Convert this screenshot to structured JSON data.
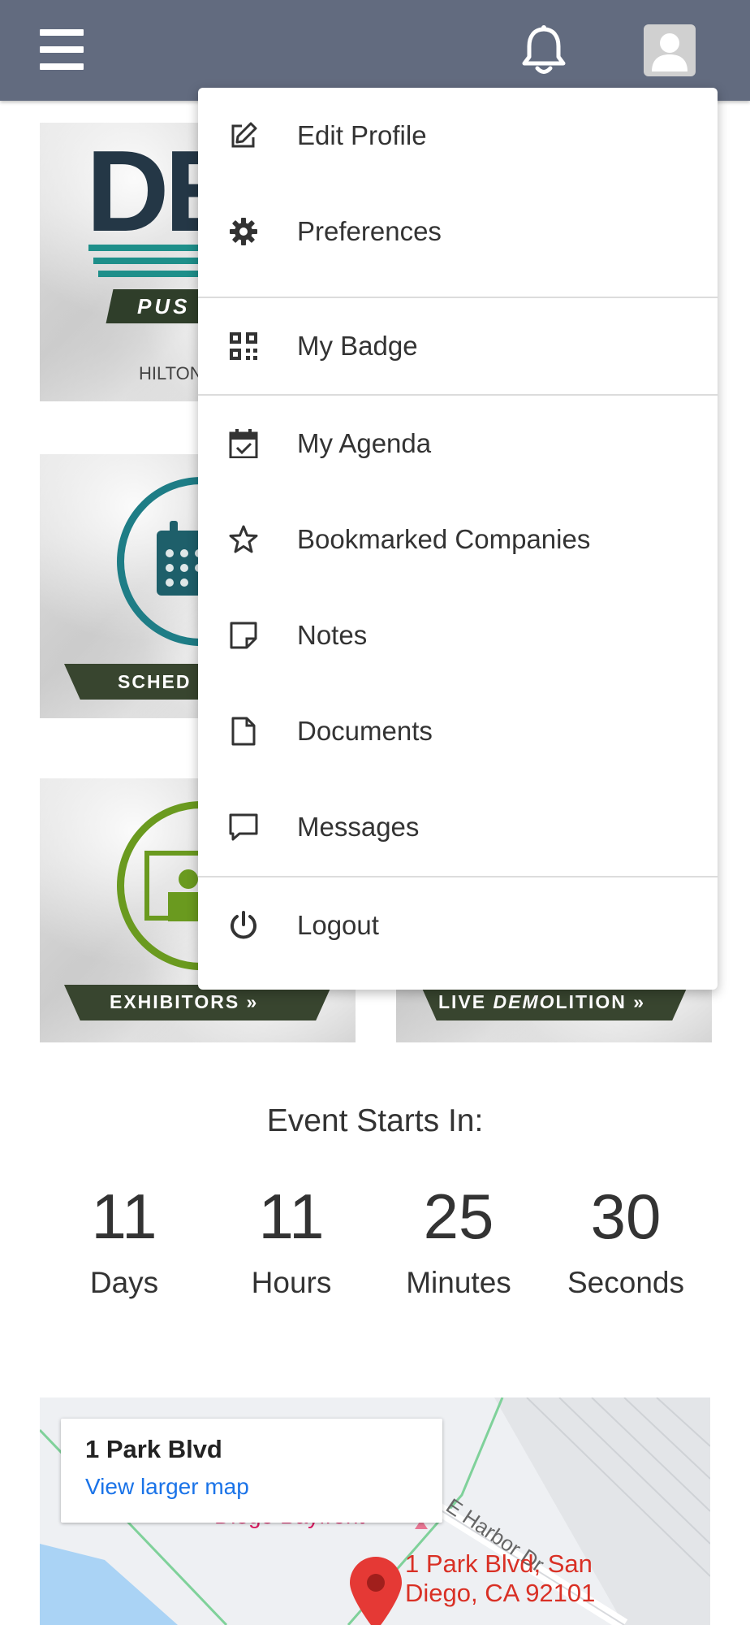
{
  "topbar": {
    "menu_icon": "hamburger-menu-icon",
    "notification_icon": "bell-icon",
    "avatar_icon": "user-avatar-icon"
  },
  "tiles": {
    "logo": {
      "text": "DE",
      "banner": "PUS",
      "sub": "HILTON"
    },
    "schedule": {
      "banner": "SCHED"
    },
    "exhibitors": {
      "banner": "EXHIBITORS »"
    },
    "demolition": {
      "banner_pre": "LIVE ",
      "banner_em": "DEMO",
      "banner_post": "LITION »"
    }
  },
  "user_menu": {
    "items": [
      {
        "label": "Edit Profile",
        "icon": "edit-icon"
      },
      {
        "label": "Preferences",
        "icon": "gear-icon"
      },
      {
        "label": "My Badge",
        "icon": "qr-code-icon"
      },
      {
        "label": "My Agenda",
        "icon": "calendar-check-icon"
      },
      {
        "label": "Bookmarked Companies",
        "icon": "star-icon"
      },
      {
        "label": "Notes",
        "icon": "note-icon"
      },
      {
        "label": "Documents",
        "icon": "document-icon"
      },
      {
        "label": "Messages",
        "icon": "message-icon"
      },
      {
        "label": "Logout",
        "icon": "power-icon"
      }
    ]
  },
  "countdown": {
    "title": "Event Starts In:",
    "units": [
      {
        "value": "11",
        "label": "Days"
      },
      {
        "value": "11",
        "label": "Hours"
      },
      {
        "value": "25",
        "label": "Minutes"
      },
      {
        "value": "30",
        "label": "Seconds"
      }
    ]
  },
  "map": {
    "place_title": "1 Park Blvd",
    "larger_map_link": "View larger map",
    "address_line1": "1 Park Blvd, San",
    "address_line2": "Diego, CA 92101",
    "street_label": "E Harbor Dr",
    "area_label": "Diego Bayfront",
    "colors": {
      "water": "#aad3f5",
      "pin": "#e53935",
      "link": "#1a73e8"
    }
  },
  "colors": {
    "topbar": "#626b7f",
    "banner_dark": "#38452f",
    "teal": "#1e8f8a",
    "green": "#6a9a1f"
  }
}
